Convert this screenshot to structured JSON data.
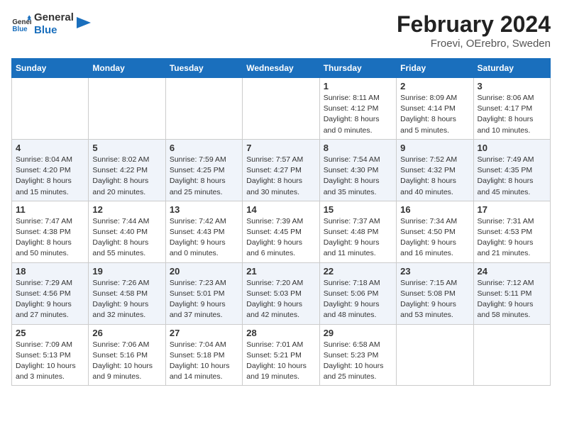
{
  "header": {
    "logo_line1": "General",
    "logo_line2": "Blue",
    "month_title": "February 2024",
    "subtitle": "Froevi, OErebro, Sweden"
  },
  "weekdays": [
    "Sunday",
    "Monday",
    "Tuesday",
    "Wednesday",
    "Thursday",
    "Friday",
    "Saturday"
  ],
  "weeks": [
    [
      {
        "day": "",
        "info": ""
      },
      {
        "day": "",
        "info": ""
      },
      {
        "day": "",
        "info": ""
      },
      {
        "day": "",
        "info": ""
      },
      {
        "day": "1",
        "info": "Sunrise: 8:11 AM\nSunset: 4:12 PM\nDaylight: 8 hours\nand 0 minutes."
      },
      {
        "day": "2",
        "info": "Sunrise: 8:09 AM\nSunset: 4:14 PM\nDaylight: 8 hours\nand 5 minutes."
      },
      {
        "day": "3",
        "info": "Sunrise: 8:06 AM\nSunset: 4:17 PM\nDaylight: 8 hours\nand 10 minutes."
      }
    ],
    [
      {
        "day": "4",
        "info": "Sunrise: 8:04 AM\nSunset: 4:20 PM\nDaylight: 8 hours\nand 15 minutes."
      },
      {
        "day": "5",
        "info": "Sunrise: 8:02 AM\nSunset: 4:22 PM\nDaylight: 8 hours\nand 20 minutes."
      },
      {
        "day": "6",
        "info": "Sunrise: 7:59 AM\nSunset: 4:25 PM\nDaylight: 8 hours\nand 25 minutes."
      },
      {
        "day": "7",
        "info": "Sunrise: 7:57 AM\nSunset: 4:27 PM\nDaylight: 8 hours\nand 30 minutes."
      },
      {
        "day": "8",
        "info": "Sunrise: 7:54 AM\nSunset: 4:30 PM\nDaylight: 8 hours\nand 35 minutes."
      },
      {
        "day": "9",
        "info": "Sunrise: 7:52 AM\nSunset: 4:32 PM\nDaylight: 8 hours\nand 40 minutes."
      },
      {
        "day": "10",
        "info": "Sunrise: 7:49 AM\nSunset: 4:35 PM\nDaylight: 8 hours\nand 45 minutes."
      }
    ],
    [
      {
        "day": "11",
        "info": "Sunrise: 7:47 AM\nSunset: 4:38 PM\nDaylight: 8 hours\nand 50 minutes."
      },
      {
        "day": "12",
        "info": "Sunrise: 7:44 AM\nSunset: 4:40 PM\nDaylight: 8 hours\nand 55 minutes."
      },
      {
        "day": "13",
        "info": "Sunrise: 7:42 AM\nSunset: 4:43 PM\nDaylight: 9 hours\nand 0 minutes."
      },
      {
        "day": "14",
        "info": "Sunrise: 7:39 AM\nSunset: 4:45 PM\nDaylight: 9 hours\nand 6 minutes."
      },
      {
        "day": "15",
        "info": "Sunrise: 7:37 AM\nSunset: 4:48 PM\nDaylight: 9 hours\nand 11 minutes."
      },
      {
        "day": "16",
        "info": "Sunrise: 7:34 AM\nSunset: 4:50 PM\nDaylight: 9 hours\nand 16 minutes."
      },
      {
        "day": "17",
        "info": "Sunrise: 7:31 AM\nSunset: 4:53 PM\nDaylight: 9 hours\nand 21 minutes."
      }
    ],
    [
      {
        "day": "18",
        "info": "Sunrise: 7:29 AM\nSunset: 4:56 PM\nDaylight: 9 hours\nand 27 minutes."
      },
      {
        "day": "19",
        "info": "Sunrise: 7:26 AM\nSunset: 4:58 PM\nDaylight: 9 hours\nand 32 minutes."
      },
      {
        "day": "20",
        "info": "Sunrise: 7:23 AM\nSunset: 5:01 PM\nDaylight: 9 hours\nand 37 minutes."
      },
      {
        "day": "21",
        "info": "Sunrise: 7:20 AM\nSunset: 5:03 PM\nDaylight: 9 hours\nand 42 minutes."
      },
      {
        "day": "22",
        "info": "Sunrise: 7:18 AM\nSunset: 5:06 PM\nDaylight: 9 hours\nand 48 minutes."
      },
      {
        "day": "23",
        "info": "Sunrise: 7:15 AM\nSunset: 5:08 PM\nDaylight: 9 hours\nand 53 minutes."
      },
      {
        "day": "24",
        "info": "Sunrise: 7:12 AM\nSunset: 5:11 PM\nDaylight: 9 hours\nand 58 minutes."
      }
    ],
    [
      {
        "day": "25",
        "info": "Sunrise: 7:09 AM\nSunset: 5:13 PM\nDaylight: 10 hours\nand 3 minutes."
      },
      {
        "day": "26",
        "info": "Sunrise: 7:06 AM\nSunset: 5:16 PM\nDaylight: 10 hours\nand 9 minutes."
      },
      {
        "day": "27",
        "info": "Sunrise: 7:04 AM\nSunset: 5:18 PM\nDaylight: 10 hours\nand 14 minutes."
      },
      {
        "day": "28",
        "info": "Sunrise: 7:01 AM\nSunset: 5:21 PM\nDaylight: 10 hours\nand 19 minutes."
      },
      {
        "day": "29",
        "info": "Sunrise: 6:58 AM\nSunset: 5:23 PM\nDaylight: 10 hours\nand 25 minutes."
      },
      {
        "day": "",
        "info": ""
      },
      {
        "day": "",
        "info": ""
      }
    ]
  ]
}
